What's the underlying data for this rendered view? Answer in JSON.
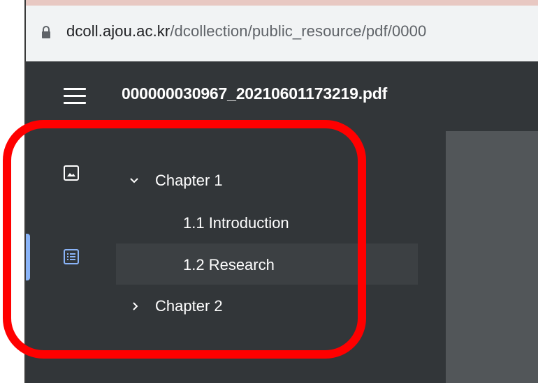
{
  "browser": {
    "url_host": "dcoll.ajou.ac.kr",
    "url_path": "/dcollection/public_resource/pdf/0000"
  },
  "toolbar": {
    "title": "000000030967_20210601173219.pdf"
  },
  "outline": {
    "chapter1": "Chapter 1",
    "section1_1": "1.1 Introduction",
    "section1_2": "1.2 Research",
    "chapter2": "Chapter 2"
  },
  "colors": {
    "toolbar_bg": "#323639",
    "viewer_bg": "#525659",
    "accent": "#8ab4f8",
    "annotation": "#ff0000"
  },
  "icons": [
    "lock-icon",
    "menu-icon",
    "thumbnail-icon",
    "outline-icon",
    "chevron-down-icon",
    "chevron-right-icon"
  ]
}
